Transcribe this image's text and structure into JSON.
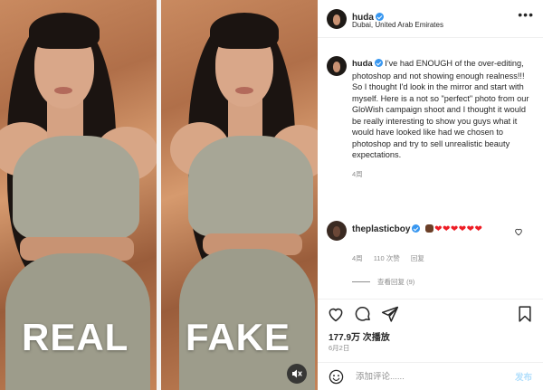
{
  "media": {
    "label_left": "REAL",
    "label_right": "FAKE"
  },
  "header": {
    "username": "huda",
    "location": "Dubai, United Arab Emirates",
    "more": "•••"
  },
  "caption": {
    "username": "huda",
    "text": "I've had ENOUGH of the over-editing, photoshop and not showing enough realness!!! So I thought I'd look in the mirror and start with myself. Here is a not so \"perfect\" photo from our GloWish campaign shoot and I thought it would be really interesting to show you guys what it would have looked like had we chosen to photoshop and try to sell unrealistic beauty expectations.",
    "time": "4周"
  },
  "comment": {
    "username": "theplasticboy",
    "text": "✊🏾❤️❤️❤️❤️❤️❤️",
    "hearts_display": "❤❤❤❤❤❤",
    "time": "4周",
    "likes": "110 次赞",
    "reply": "回复",
    "view_replies": "查看回复 (9)"
  },
  "post": {
    "likes": "177.9万 次播放",
    "date": "6月2日"
  },
  "comment_box": {
    "placeholder": "添加评论......",
    "post_label": "发布"
  },
  "colors": {
    "accent": "#3897f0",
    "post_disabled": "#b2dffc",
    "heart": "#ed1c24",
    "text": "#262626",
    "secondary": "#8e8e8e"
  }
}
